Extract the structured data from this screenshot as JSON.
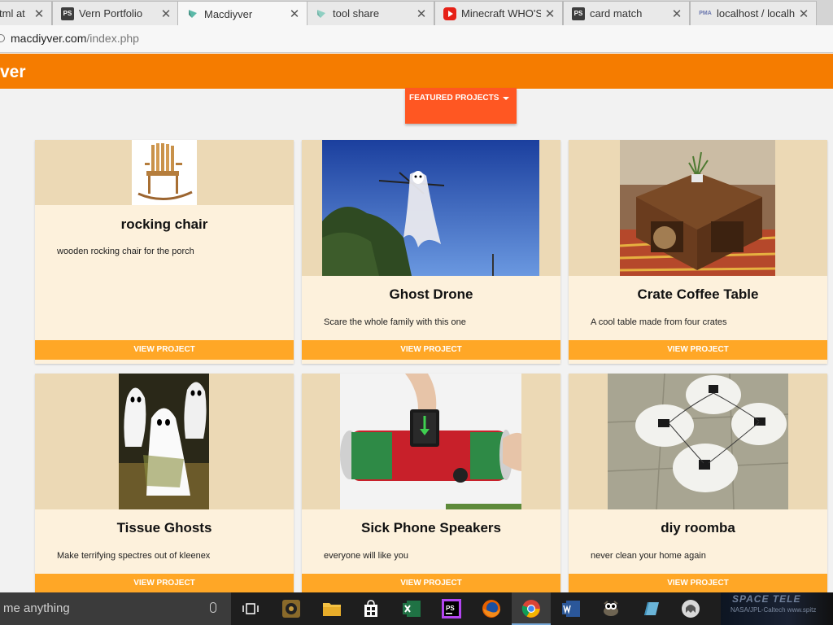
{
  "browser": {
    "tabs": [
      {
        "title": "tml at",
        "favicon": "generic-icon"
      },
      {
        "title": "Vern Portfolio",
        "favicon": "phpstorm-icon"
      },
      {
        "title": "Macdiyver",
        "favicon": "macdiyver-icon",
        "active": true
      },
      {
        "title": "tool share",
        "favicon": "toolshare-icon"
      },
      {
        "title": "Minecraft WHO'S",
        "favicon": "youtube-icon"
      },
      {
        "title": "card match",
        "favicon": "phpstorm-icon"
      },
      {
        "title": "localhost / localhc",
        "favicon": "phpmyadmin-icon"
      }
    ],
    "address": {
      "domain": "macdiyver.com",
      "path": "/index.php"
    }
  },
  "site": {
    "title": "ver",
    "featured_label": "FEATURED PROJECTS",
    "accent_color": "#f57c00",
    "button_color": "#ff5722",
    "view_color": "#ffa726"
  },
  "projects": [
    {
      "name": "rocking chair",
      "description": "wooden rocking chair for the porch",
      "button": "VIEW PROJECT",
      "image": "rocking-chair-image"
    },
    {
      "name": "Ghost Drone",
      "description": "Scare the whole family with this one",
      "button": "VIEW PROJECT",
      "image": "ghost-drone-image"
    },
    {
      "name": "Crate Coffee Table",
      "description": "A cool table made from four crates",
      "button": "VIEW PROJECT",
      "image": "crate-table-image"
    },
    {
      "name": "Tissue Ghosts",
      "description": "Make terrifying spectres out of kleenex",
      "button": "VIEW PROJECT",
      "image": "tissue-ghosts-image"
    },
    {
      "name": "Sick Phone Speakers",
      "description": "everyone will like you",
      "button": "VIEW PROJECT",
      "image": "phone-speakers-image"
    },
    {
      "name": "diy roomba",
      "description": "never clean your home again",
      "button": "VIEW PROJECT",
      "image": "diy-roomba-image"
    }
  ],
  "taskbar": {
    "search_text": "me anything",
    "tray_line1": "SPACE TELE",
    "tray_line2": "NASA/JPL-Caltech   www.spitz"
  }
}
